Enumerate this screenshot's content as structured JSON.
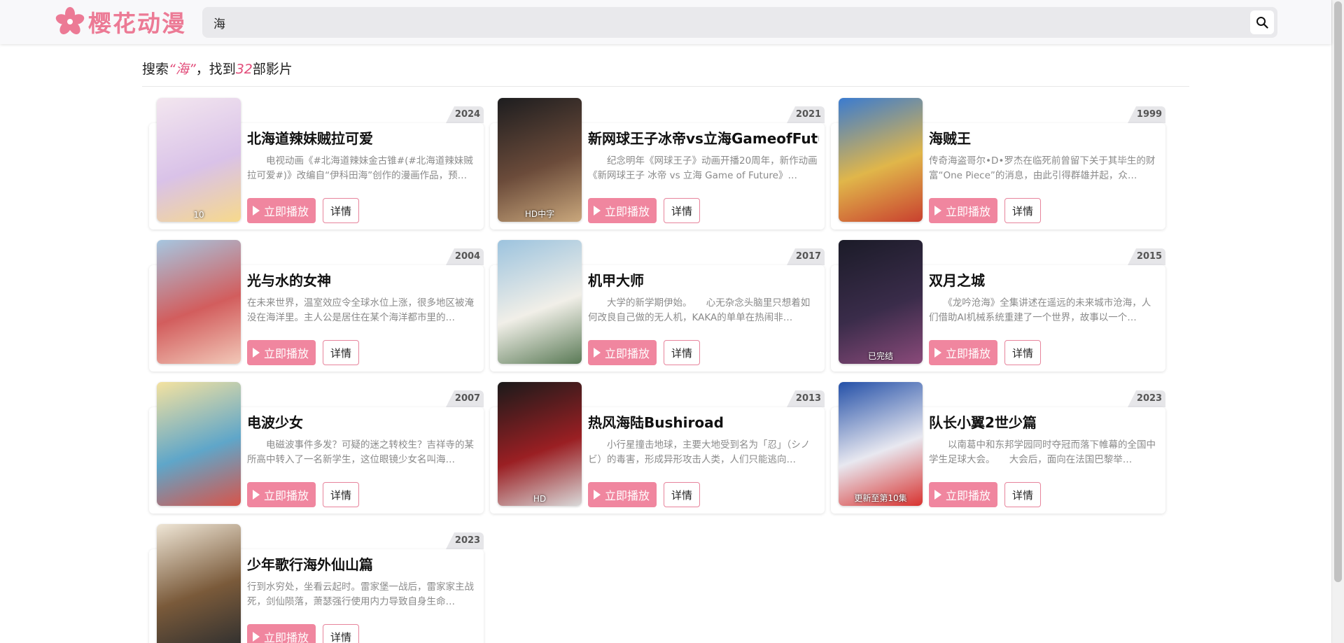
{
  "header": {
    "logo_text": "樱花动漫",
    "search_value": "海",
    "search_icon": "search-icon"
  },
  "result": {
    "prefix": "搜索",
    "keyword": "“海”",
    "middle": "，找到",
    "count": "32",
    "suffix": "部影片"
  },
  "labels": {
    "play": "立即播放",
    "detail": "详情"
  },
  "cards": [
    {
      "title": "北海道辣妹贼拉可爱",
      "year": "2024",
      "desc": "　　电视动画《#北海道辣妹金古锥#(#北海道辣妹贼拉可爱#)》改编自“伊科田海”创作的漫画作品，预…",
      "poster_label": "10",
      "colors": [
        "#f3e6ef",
        "#d9c2e8",
        "#f7d98c"
      ]
    },
    {
      "title": "新网球王子冰帝vs立海GameofFutu",
      "year": "2021",
      "desc": "　　纪念明年《网球王子》动画开播20周年，新作动画《新网球王子 冰帝 vs 立海 Game of Future》…",
      "poster_label": "HD中字",
      "colors": [
        "#1d1d1f",
        "#6b4b3a",
        "#c9a77c"
      ]
    },
    {
      "title": "海贼王",
      "year": "1999",
      "desc": "传奇海盗哥尔•D•罗杰在临死前曾留下关于其毕生的财富“One Piece”的消息，由此引得群雄并起，众…",
      "poster_label": "",
      "colors": [
        "#3a7bd0",
        "#e0b64a",
        "#c9402f"
      ]
    },
    {
      "title": "光与水的女神",
      "year": "2004",
      "desc": "在未来世界，温室效应令全球水位上涨，很多地区被淹没在海洋里。主人公是居住在某个海洋都市里的…",
      "poster_label": "",
      "colors": [
        "#a6c6e0",
        "#d25d5d",
        "#f2c8b8"
      ]
    },
    {
      "title": "机甲大师",
      "year": "2017",
      "desc": "　　大学的新学期伊始。　　心无杂念头脑里只想着如何改良自己做的无人机，KAKA的单单在热闹非…",
      "poster_label": "",
      "colors": [
        "#9cc3de",
        "#f1efe8",
        "#5a7a56"
      ]
    },
    {
      "title": "双月之城",
      "year": "2015",
      "desc": "　　《龙吟沧海》全集讲述在遥远的未来城市沧海，人们借助AI机械系统重建了一个世界，故事以一个…",
      "poster_label": "已完结",
      "colors": [
        "#1b1b28",
        "#3a2c4a",
        "#8a4a7a"
      ]
    },
    {
      "title": "电波少女",
      "year": "2007",
      "desc": "　　电磁波事件多发？可疑的迷之转校生？吉祥寺的某所高中转入了一名新学生，这位眼镜少女名叫海…",
      "poster_label": "",
      "colors": [
        "#f4e2a0",
        "#5fa6c9",
        "#d8544a"
      ]
    },
    {
      "title": "热风海陆Bushiroad",
      "year": "2013",
      "desc": "　　小行星撞击地球，主要大地受到名为「忍」（シノビ）的毒害，形成异形攻击人类，人们只能逃向…",
      "poster_label": "HD",
      "colors": [
        "#1a1a1a",
        "#9a1f23",
        "#d9d9d9"
      ]
    },
    {
      "title": "队长小翼2世少篇",
      "year": "2023",
      "desc": "　　以南葛中和东邦学园同时夺冠而落下帷幕的全国中学生足球大会。　　大会后，面向在法国巴黎举…",
      "poster_label": "更新至第10集",
      "colors": [
        "#2450a8",
        "#e8e8f0",
        "#d8322f"
      ]
    },
    {
      "title": "少年歌行海外仙山篇",
      "year": "2023",
      "desc": "行到水穷处，坐看云起时。雷家堡一战后，雷家家主战死，剑仙陨落，萧瑟强行使用内力导致自身生命…",
      "poster_label": "",
      "colors": [
        "#efe6d6",
        "#7a5a3a",
        "#2f2f2f"
      ]
    }
  ]
}
